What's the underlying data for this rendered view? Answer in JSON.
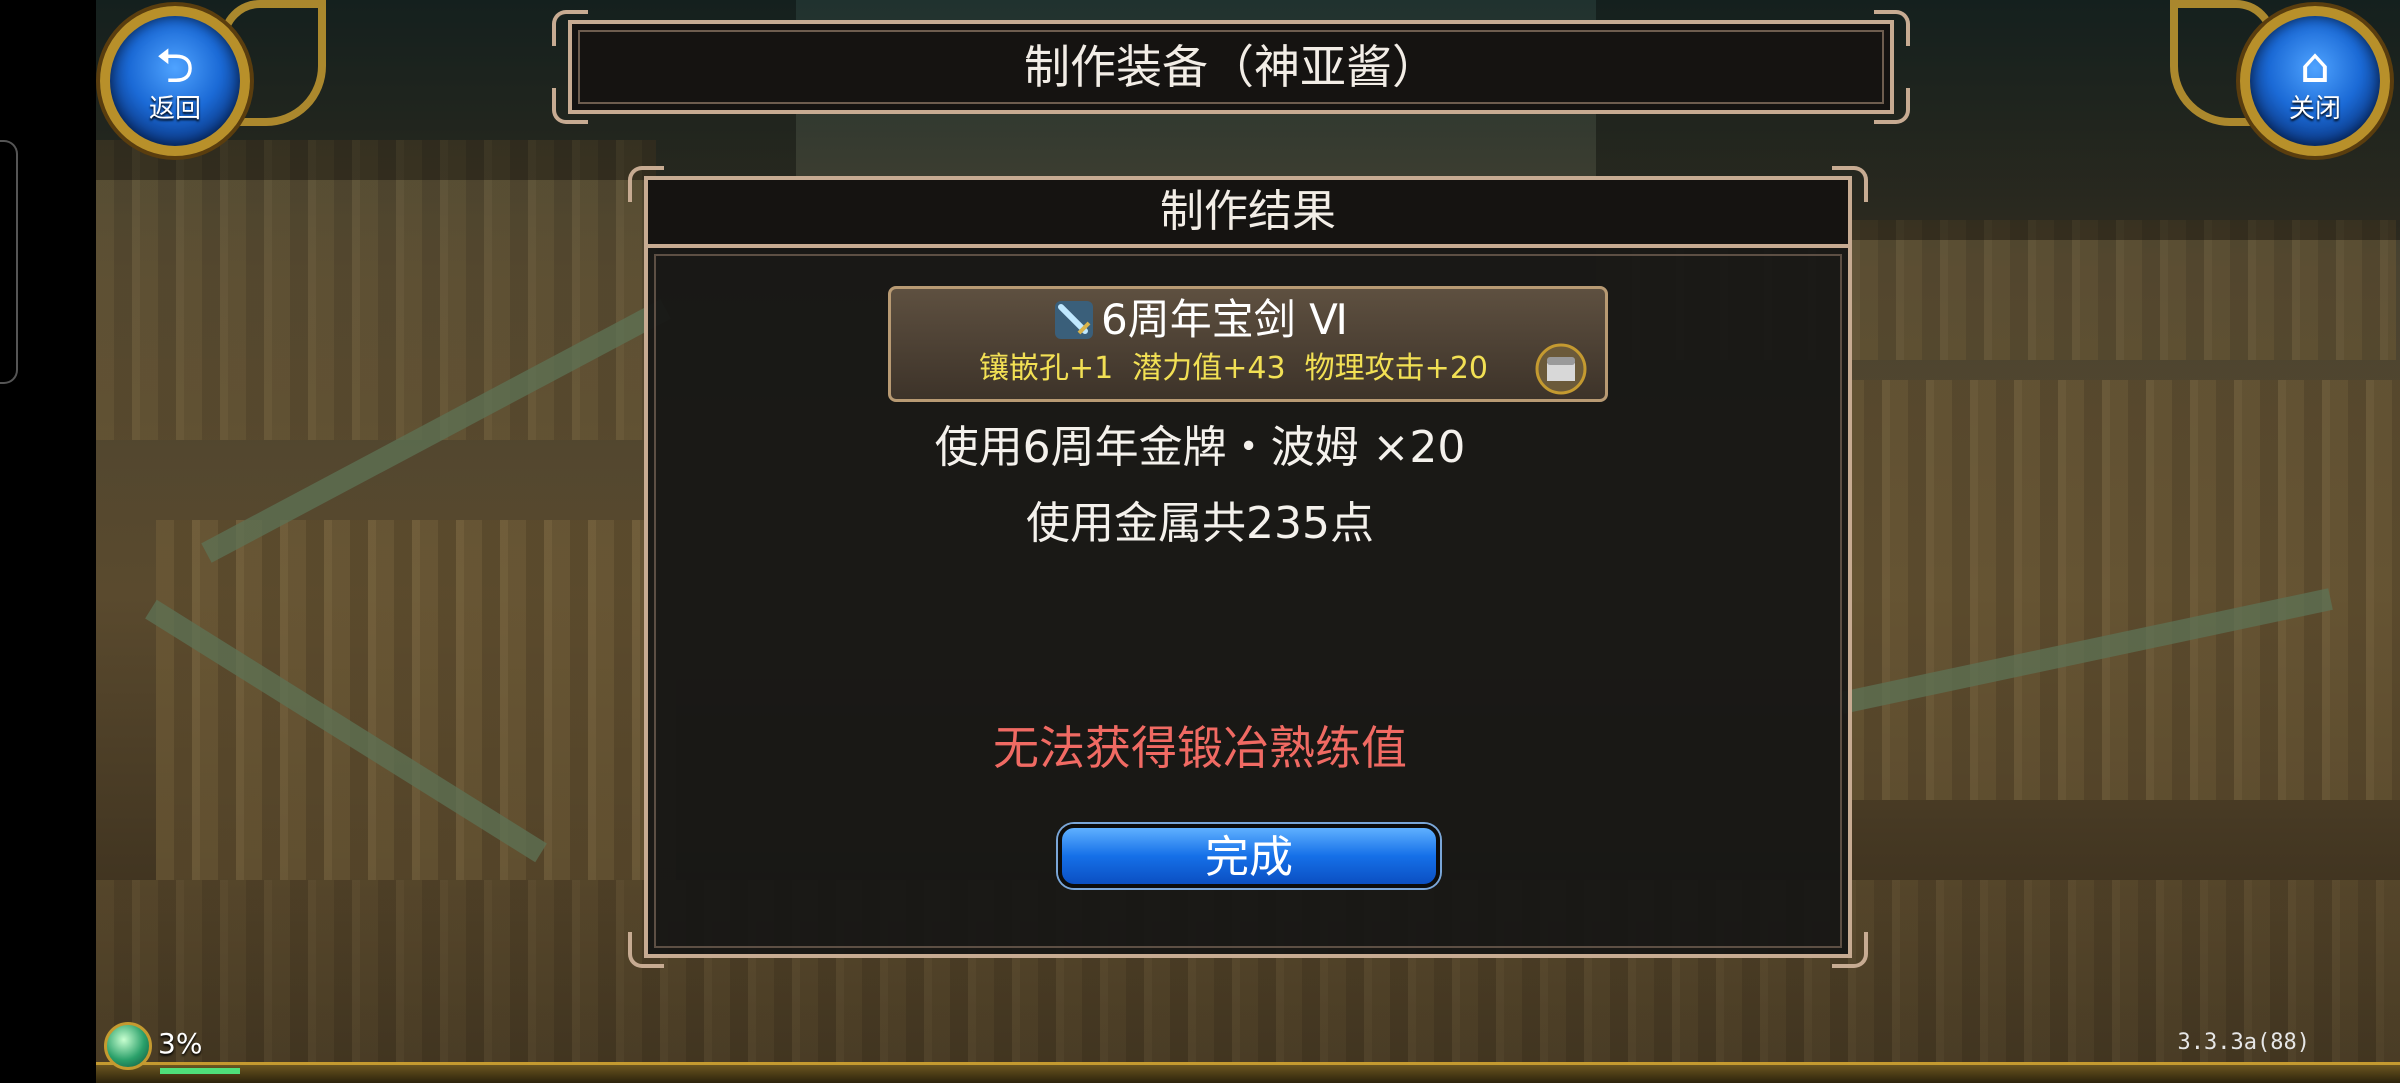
{
  "corner_buttons": {
    "back": {
      "label": "返回",
      "icon": "back-arrow-icon"
    },
    "close": {
      "label": "关闭",
      "icon": "home-icon"
    }
  },
  "window_title": "制作装备（神亚酱）",
  "dialog": {
    "title": "制作结果",
    "item": {
      "name": "6周年宝剑 Ⅵ",
      "stats": "镶嵌孔+1  潜力值+43  物理攻击+20",
      "icon": "sword-icon",
      "badge_icon": "chest-icon"
    },
    "material_line": "使用6周年金牌・波姆 ×20",
    "metal_line": "使用金属共235点",
    "warning": "无法获得锻冶熟练值",
    "done_label": "完成"
  },
  "hud": {
    "percent": "3%",
    "version": "3.3.3a(88)"
  },
  "colors": {
    "panel_border": "#c7ab92",
    "stat_yellow": "#f2e054",
    "warning_red": "#f06a63",
    "button_blue": "#1570e8"
  }
}
